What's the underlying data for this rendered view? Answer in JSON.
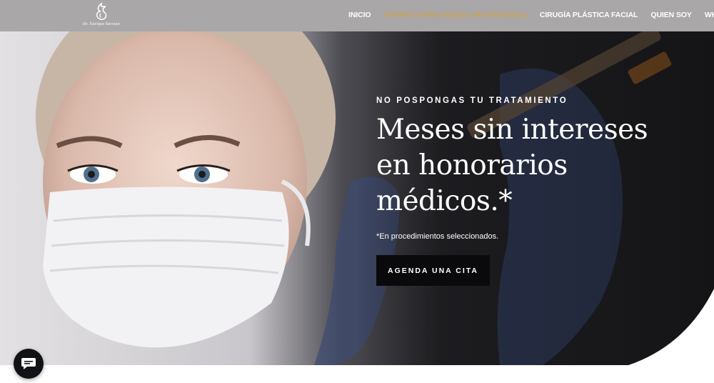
{
  "header": {
    "logo_text": "Dr. Enrique Serrano",
    "nav": [
      {
        "label": "INICIO"
      },
      {
        "label": "PROMOCIONES MESES SIN INTERESES"
      },
      {
        "label": "CIRUGÍA PLÁSTICA FACIAL"
      },
      {
        "label": "QUIEN SOY"
      },
      {
        "label": "WHATSAPP"
      }
    ]
  },
  "hero": {
    "eyebrow": "NO POSPONGAS TU TRATAMIENTO",
    "headline": [
      "Meses sin intereses",
      "en honorarios",
      "médicos.*"
    ],
    "note": "*En procedimientos seleccionados.",
    "cta": "AGENDA UNA CITA"
  },
  "colors": {
    "header_bg": "#a9a7a8",
    "nav_active": "#c9a45c",
    "cta_bg": "#0a0a0c",
    "hero_dark": "#2b2b30"
  },
  "icons": {
    "logo": "flame-monogram-icon",
    "chat": "chat-bubble-icon"
  }
}
